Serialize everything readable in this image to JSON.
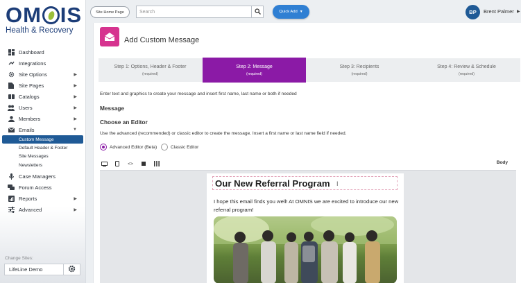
{
  "sidebar": {
    "logo": {
      "word": "OMNIS",
      "tagline": "Health & Recovery"
    },
    "items": [
      {
        "label": "Dashboard",
        "icon": "dashboard-icon",
        "chevron": false
      },
      {
        "label": "Integrations",
        "icon": "integrations-icon",
        "chevron": false
      },
      {
        "label": "Site Options",
        "icon": "gear-icon",
        "chevron": true
      },
      {
        "label": "Site Pages",
        "icon": "page-icon",
        "chevron": true
      },
      {
        "label": "Catalogs",
        "icon": "catalog-icon",
        "chevron": true
      },
      {
        "label": "Users",
        "icon": "users-icon",
        "chevron": true
      },
      {
        "label": "Members",
        "icon": "members-icon",
        "chevron": true
      },
      {
        "label": "Emails",
        "icon": "envelope-icon",
        "chevron": true
      }
    ],
    "email_subitems": [
      {
        "label": "Custom Message",
        "active": true
      },
      {
        "label": "Default Header & Footer",
        "active": false
      },
      {
        "label": "Site Messages",
        "active": false
      },
      {
        "label": "Newsletters",
        "active": false
      }
    ],
    "items_after": [
      {
        "label": "Case Managers",
        "icon": "microphone-icon",
        "chevron": false
      },
      {
        "label": "Forum Access",
        "icon": "chat-icon",
        "chevron": false
      },
      {
        "label": "Reports",
        "icon": "reports-icon",
        "chevron": true
      },
      {
        "label": "Advanced",
        "icon": "sliders-icon",
        "chevron": true
      }
    ],
    "change_sites_label": "Change Sites:",
    "site_value": "LifeLine Demo"
  },
  "topbar": {
    "home_button": "Site Home Page",
    "search_placeholder": "Search",
    "quick_add": "Quick Add",
    "user_initials": "BP",
    "user_name": "Brent Palmer"
  },
  "main": {
    "title": "Add Custom Message",
    "steps": [
      {
        "title": "Step 1: Options, Header & Footer",
        "req": "(required)",
        "active": false
      },
      {
        "title": "Step 2: Message",
        "req": "(required)",
        "active": true
      },
      {
        "title": "Step 3: Recipients",
        "req": "(required)",
        "active": false
      },
      {
        "title": "Step 4: Review & Schedule",
        "req": "(required)",
        "active": false
      }
    ],
    "intro": "Enter text and graphics to create your message and insert first name, last name or both if needed",
    "message_heading": "Message",
    "editor_heading": "Choose an Editor",
    "editor_desc": "Use the advanced (recommended) or classic editor to create the message. Insert a first name or last name field if needed.",
    "radio_advanced": "Advanced Editor (Beta)",
    "radio_classic": "Classic Editor",
    "selected_editor": "advanced",
    "toolbar_body_label": "Body",
    "email": {
      "title": "Our New Referral Program",
      "body": "I hope this email finds you well! At OMNIS we are excited to introduce our new referral program!"
    }
  },
  "colors": {
    "brand_navy": "#1c3d78",
    "active_step": "#8b1aa6",
    "active_nav": "#1f5a96",
    "quick_add": "#2f7fd3",
    "header_icon": "#d6338f"
  }
}
